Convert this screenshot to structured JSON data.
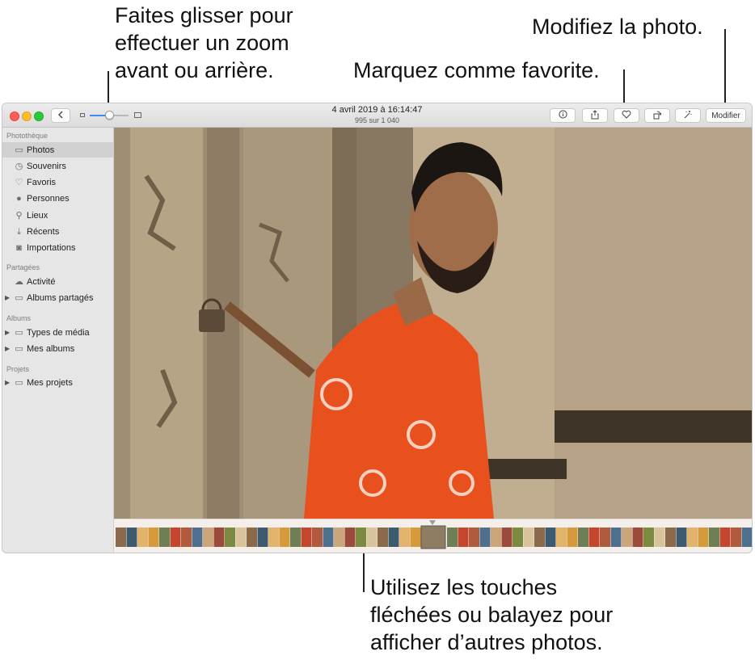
{
  "callouts": {
    "zoom": "Faites glisser pour\neffectuer un zoom\navant ou arrière.",
    "edit": "Modifiez la photo.",
    "favorite": "Marquez comme favorite.",
    "arrows": "Utilisez les touches\nfléchées ou balayez pour\nafficher d’autres photos."
  },
  "toolbar": {
    "date": "4 avril 2019 à 16:14:47",
    "count": "995 sur 1 040",
    "edit_label": "Modifier",
    "back_icon": "chevron-left-icon",
    "info_icon": "info-icon",
    "share_icon": "share-icon",
    "favorite_icon": "heart-icon",
    "rotate_icon": "rotate-icon",
    "enhance_icon": "magic-wand-icon",
    "zoom_value": 0.5
  },
  "sidebar": {
    "sections": [
      {
        "header": "Photothèque",
        "items": [
          {
            "label": "Photos",
            "icon": "photos-icon",
            "selected": true
          },
          {
            "label": "Souvenirs",
            "icon": "memories-icon"
          },
          {
            "label": "Favoris",
            "icon": "heart-icon"
          },
          {
            "label": "Personnes",
            "icon": "person-icon"
          },
          {
            "label": "Lieux",
            "icon": "pin-icon"
          },
          {
            "label": "Récents",
            "icon": "recents-icon"
          },
          {
            "label": "Importations",
            "icon": "camera-icon"
          }
        ]
      },
      {
        "header": "Partagées",
        "items": [
          {
            "label": "Activité",
            "icon": "cloud-icon"
          },
          {
            "label": "Albums partagés",
            "icon": "folder-icon",
            "disclosure": true
          }
        ]
      },
      {
        "header": "Albums",
        "items": [
          {
            "label": "Types de média",
            "icon": "folder-icon",
            "disclosure": true
          },
          {
            "label": "Mes albums",
            "icon": "folder-icon",
            "disclosure": true
          }
        ]
      },
      {
        "header": "Projets",
        "items": [
          {
            "label": "Mes projets",
            "icon": "folder-icon",
            "disclosure": true
          }
        ]
      }
    ]
  },
  "colors": {
    "accent": "#3d8df5",
    "shirt": "#e8501e",
    "wall": "#bba98e",
    "door": "#9a8a72"
  }
}
